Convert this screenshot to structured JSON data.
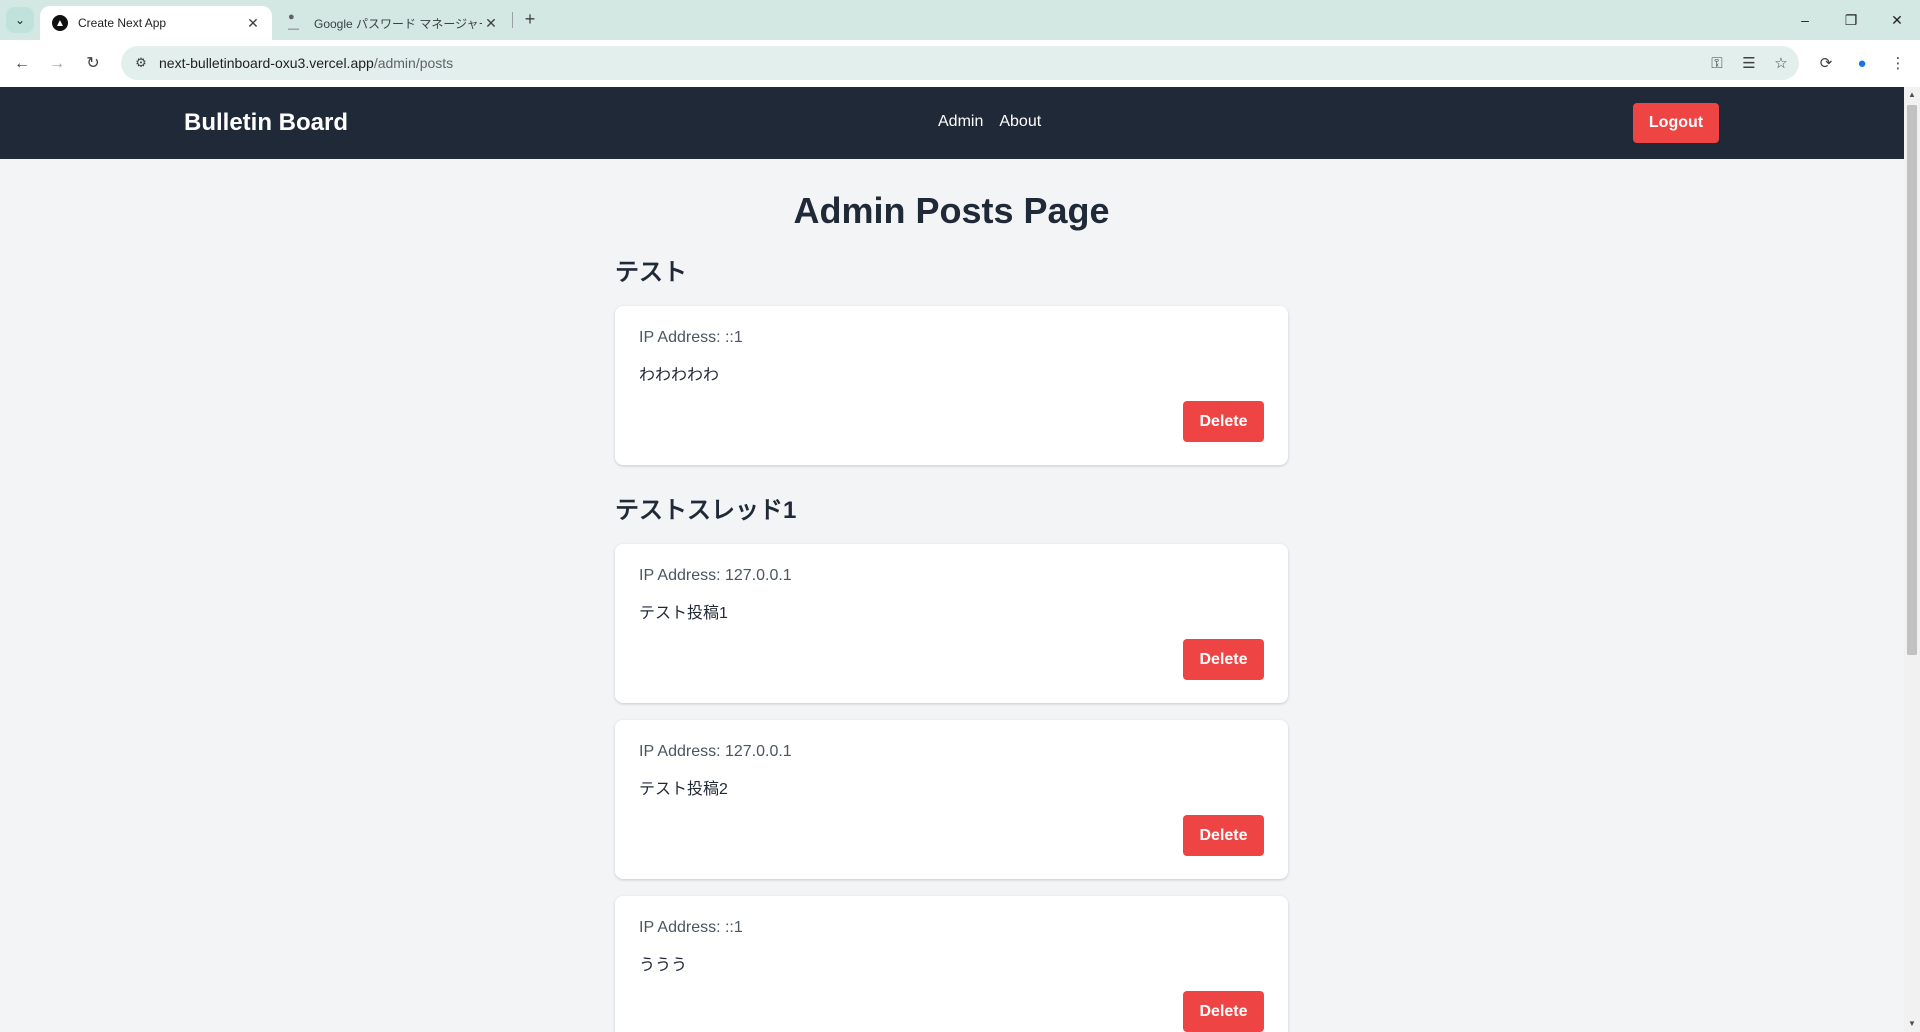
{
  "browser": {
    "tabs": [
      {
        "title": "Create Next App",
        "favicon": "nextjs-icon",
        "active": true
      },
      {
        "title": "Google パスワード マネージャー",
        "favicon": "google-password-icon",
        "active": false
      }
    ],
    "url_host": "next-bulletinboard-oxu3.vercel.app",
    "url_path": "/admin/posts"
  },
  "header": {
    "brand": "Bulletin Board",
    "nav": [
      "Admin",
      "About"
    ],
    "logout_label": "Logout"
  },
  "page": {
    "title": "Admin Posts Page"
  },
  "threads": [
    {
      "title": "テスト",
      "posts": [
        {
          "ip_label": "IP Address: ::1",
          "body": "わわわわわ",
          "delete_label": "Delete"
        }
      ]
    },
    {
      "title": "テストスレッド1",
      "posts": [
        {
          "ip_label": "IP Address: 127.0.0.1",
          "body": "テスト投稿1",
          "delete_label": "Delete"
        },
        {
          "ip_label": "IP Address: 127.0.0.1",
          "body": "テスト投稿2",
          "delete_label": "Delete"
        },
        {
          "ip_label": "IP Address: ::1",
          "body": "ううう",
          "delete_label": "Delete"
        }
      ]
    }
  ],
  "colors": {
    "header_bg": "#1f2937",
    "danger": "#ef4444",
    "page_bg": "#f3f4f6"
  }
}
